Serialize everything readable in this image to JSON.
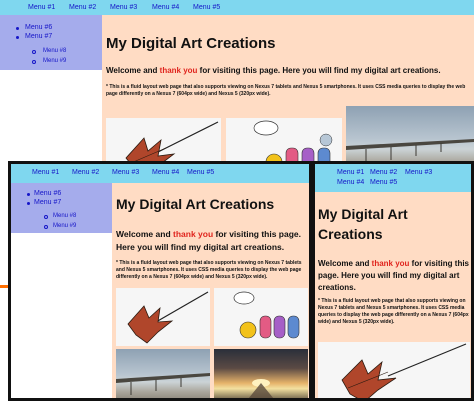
{
  "menu": [
    "Menu #1",
    "Menu #2",
    "Menu #3",
    "Menu #4",
    "Menu #5"
  ],
  "sidebar": {
    "items": [
      "Menu #6",
      "Menu #7"
    ],
    "subitems": [
      "Menu #8",
      "Menu #9"
    ]
  },
  "page": {
    "title": "My Digital Art Creations",
    "welcome_before": "Welcome and ",
    "welcome_accent": "thank you",
    "welcome_after": " for visiting this page. Here you will find my digital art creations.",
    "note": "* This is a fluid layout web page that also supports viewing on Nexus 7 tablets and Nexus 5 smartphones. It uses CSS media queries to display the web page differently on a Nexus 7 (604px wide) and Nexus 5 (320px wide)."
  },
  "colors": {
    "menu_bar": "#7fd7ef",
    "sidebar": "#a5acec",
    "content": "#ffdcc4",
    "link": "#1515c8",
    "accent": "#e0251e"
  },
  "icons": [
    "maple-leaf-art",
    "cartoon-characters-art",
    "pier-photo",
    "sunset-photo"
  ]
}
